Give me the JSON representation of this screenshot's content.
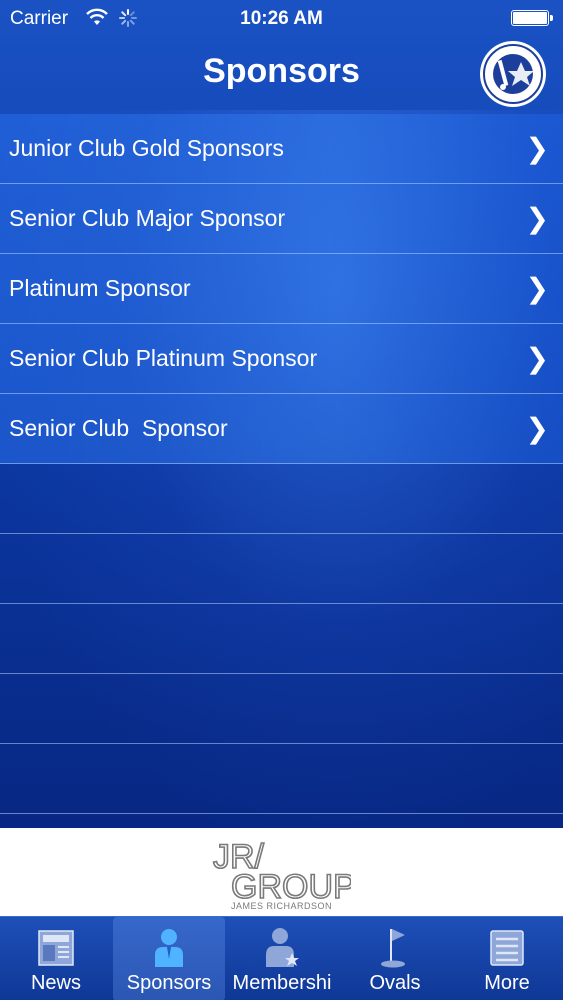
{
  "status_bar": {
    "carrier": "Carrier",
    "time": "10:26 AM"
  },
  "nav": {
    "title": "Sponsors",
    "logo_icon": "maccabi-ajax-cricket-club-logo-icon"
  },
  "sponsor_list": {
    "items": [
      {
        "label": "Junior Club Gold Sponsors"
      },
      {
        "label": "Senior Club Major Sponsor"
      },
      {
        "label": "Platinum Sponsor"
      },
      {
        "label": "Senior Club Platinum Sponsor"
      },
      {
        "label": "Senior Club  Sponsor"
      }
    ],
    "chevron": "❯"
  },
  "banner": {
    "logo_text_top": "JR/",
    "logo_text_main": "GROUP",
    "logo_text_sub": "JAMES RICHARDSON"
  },
  "tab_bar": {
    "tabs": [
      {
        "label": "News",
        "icon": "newspaper-icon"
      },
      {
        "label": "Sponsors",
        "icon": "person-icon"
      },
      {
        "label": "Membershi",
        "icon": "member-badge-icon"
      },
      {
        "label": "Ovals",
        "icon": "flag-icon"
      },
      {
        "label": "More",
        "icon": "list-icon"
      }
    ],
    "active_index": 1
  },
  "colors": {
    "background": "#0c3aa6",
    "text": "#ffffff"
  }
}
